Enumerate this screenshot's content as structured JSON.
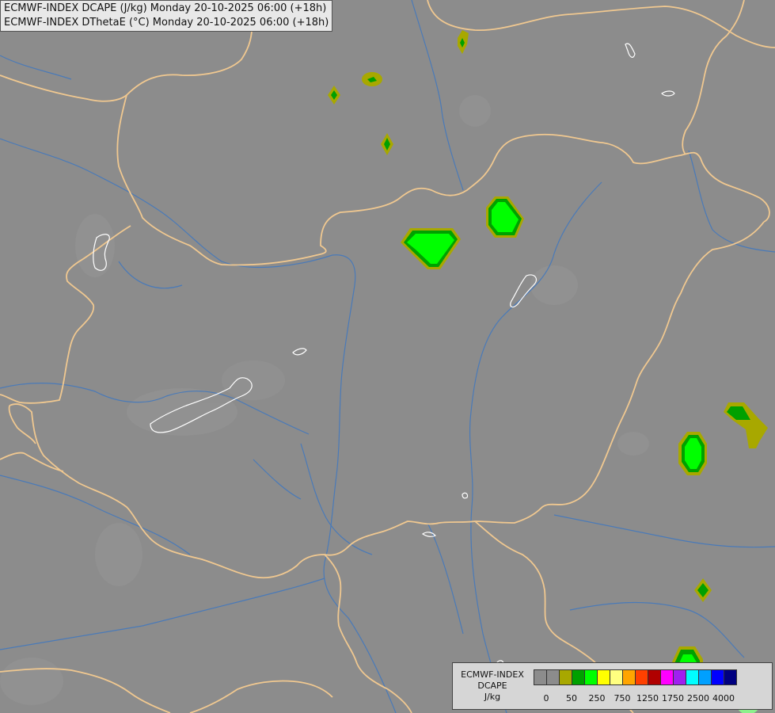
{
  "title": {
    "line1": "ECMWF-INDEX DCAPE (J/kg) Monday 20-10-2025 06:00 (+18h)",
    "line2": "ECMWF-INDEX DThetaE (°C) Monday 20-10-2025 06:00 (+18h)"
  },
  "legend": {
    "line1": "ECMWF-INDEX",
    "line2": "DCAPE",
    "unit": "J/kg",
    "colors": [
      "#8c8c8c",
      "#8c8c8c",
      "#a8a800",
      "#00a000",
      "#00ff00",
      "#ffff00",
      "#ffff80",
      "#ffa500",
      "#ff4000",
      "#b00000",
      "#ff00ff",
      "#a020f0",
      "#00ffff",
      "#00a0ff",
      "#0000ff",
      "#000080"
    ],
    "tick_labels": [
      "0",
      "50",
      "250",
      "750",
      "1250",
      "1750",
      "2500",
      "4000"
    ]
  },
  "colors": {
    "background": "#8c8c8c",
    "border": "#f0c890",
    "river": "#4a7ab8",
    "lake": "#ffffff",
    "dcape_low": "#a8a800",
    "dcape_mid": "#00a000",
    "dcape_high": "#00ff00"
  }
}
